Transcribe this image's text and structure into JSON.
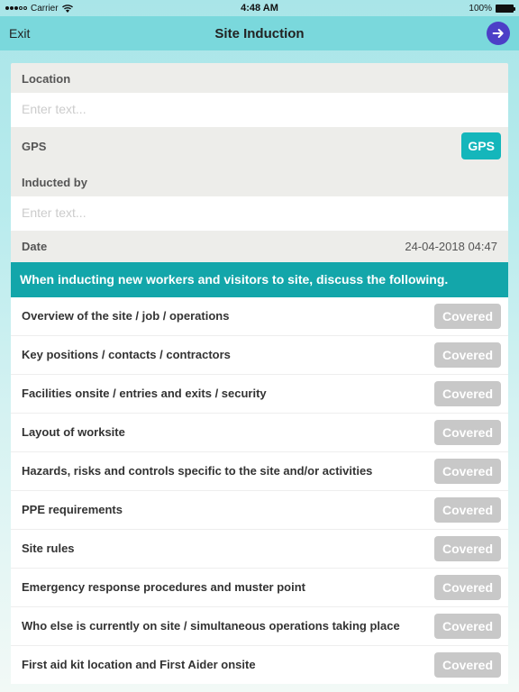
{
  "statusbar": {
    "carrier": "Carrier",
    "time": "4:48 AM",
    "battery_pct": "100%"
  },
  "navbar": {
    "exit": "Exit",
    "title": "Site Induction"
  },
  "form": {
    "location_label": "Location",
    "location_placeholder": "Enter text...",
    "location_value": "",
    "gps_label": "GPS",
    "gps_button": "GPS",
    "inducted_by_label": "Inducted by",
    "inducted_by_placeholder": "Enter text...",
    "inducted_by_value": "",
    "date_label": "Date",
    "date_value": "24-04-2018 04:47"
  },
  "section": {
    "banner": "When inducting new workers and visitors to site, discuss the following.",
    "covered_label": "Covered",
    "items": [
      "Overview of the site / job / operations",
      "Key positions / contacts / contractors",
      "Facilities onsite / entries and exits / security",
      "Layout of worksite",
      "Hazards, risks and controls specific to the site and/or activities",
      "PPE requirements",
      "Site rules",
      "Emergency response procedures and muster point",
      "Who else is currently on site / simultaneous operations taking place",
      "First aid kit location and First Aider onsite"
    ]
  }
}
